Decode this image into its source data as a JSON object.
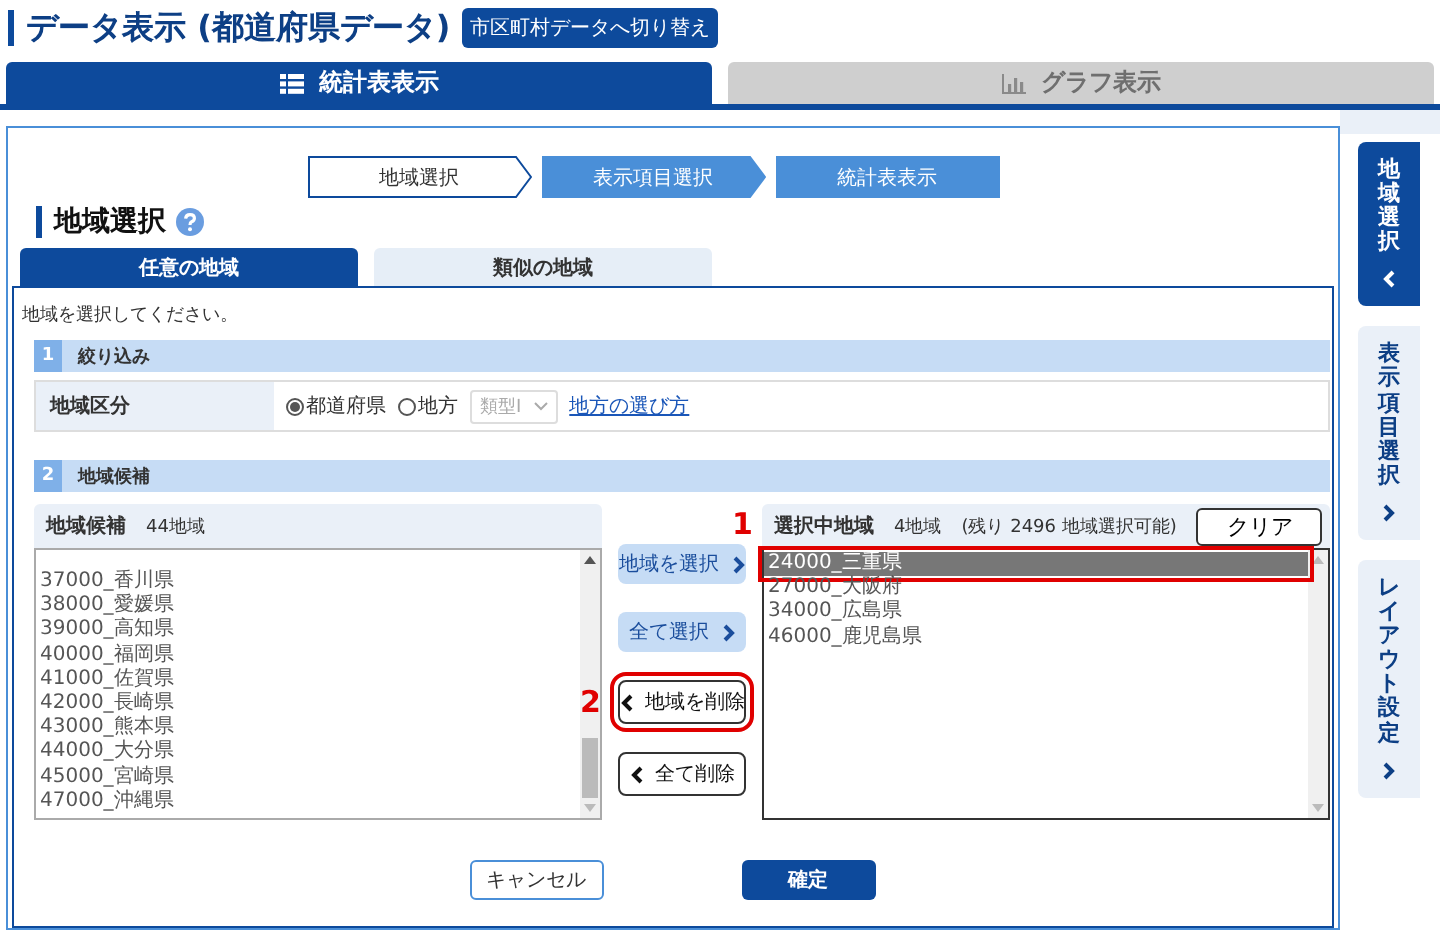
{
  "header": {
    "title": "データ表示 (都道府県データ)",
    "switch_button": "市区町村データへ切り替え"
  },
  "view_tabs": [
    {
      "label": "統計表表示",
      "selected": true
    },
    {
      "label": "グラフ表示",
      "selected": false
    }
  ],
  "steps": [
    {
      "label": "地域選択",
      "selected": true
    },
    {
      "label": "表示項目選択",
      "selected": false
    },
    {
      "label": "統計表表示",
      "selected": false
    }
  ],
  "section_title": "地域選択",
  "sub_tabs": [
    {
      "label": "任意の地域",
      "selected": true
    },
    {
      "label": "類似の地域",
      "selected": false
    }
  ],
  "instruction": "地域を選択してください。",
  "filter": {
    "number": "1",
    "title": "絞り込み",
    "label": "地域区分",
    "options": [
      {
        "label": "都道府県",
        "checked": true
      },
      {
        "label": "地方",
        "checked": false
      }
    ],
    "dropdown": {
      "value": "類型Ⅰ",
      "disabled": true
    },
    "link": "地方の選び方"
  },
  "candidates": {
    "number": "2",
    "title": "地域候補",
    "list_title": "地域候補",
    "count": "44地域",
    "items": [
      {
        "label": "37000_香川県"
      },
      {
        "label": "38000_愛媛県"
      },
      {
        "label": "39000_高知県"
      },
      {
        "label": "40000_福岡県"
      },
      {
        "label": "41000_佐賀県"
      },
      {
        "label": "42000_長崎県"
      },
      {
        "label": "43000_熊本県"
      },
      {
        "label": "44000_大分県"
      },
      {
        "label": "45000_宮崎県"
      },
      {
        "label": "47000_沖縄県"
      }
    ]
  },
  "transfer_buttons": [
    {
      "label": "地域を選択",
      "kind": "add",
      "disabled": true
    },
    {
      "label": "全て選択",
      "kind": "add",
      "disabled": true
    },
    {
      "label": "地域を削除",
      "kind": "remove",
      "disabled": false,
      "callout": "2"
    },
    {
      "label": "全て削除",
      "kind": "remove",
      "disabled": false
    }
  ],
  "selected_list": {
    "title": "選択中地域",
    "count": "4地域",
    "remaining": "(残り 2496 地域選択可能)",
    "clear_button": "クリア",
    "items": [
      {
        "label": "24000_三重県",
        "selected": true,
        "callout": "1"
      },
      {
        "label": "27000_大阪府",
        "selected": false
      },
      {
        "label": "34000_広島県",
        "selected": false
      },
      {
        "label": "46000_鹿児島県",
        "selected": false
      }
    ]
  },
  "footer_buttons": [
    {
      "label": "キャンセル",
      "kind": "secondary"
    },
    {
      "label": "確定",
      "kind": "primary"
    }
  ],
  "side_tabs": [
    {
      "label": "地域選択",
      "selected": true
    },
    {
      "label": "表示項目選択",
      "selected": false
    },
    {
      "label": "レイアウト設定",
      "selected": false
    }
  ]
}
